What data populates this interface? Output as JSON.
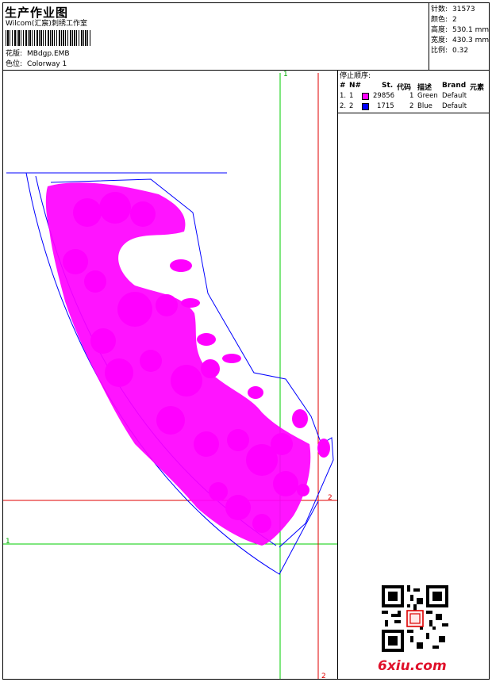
{
  "header": {
    "title": "生产作业图",
    "studio": "Wilcom(汇宸)刺绣工作室",
    "design_label": "花版:",
    "design_value": "MBdgp.EMB",
    "colorway_label": "色位:",
    "colorway_value": "Colorway 1"
  },
  "stats": [
    {
      "label": "针数:",
      "value": "31573"
    },
    {
      "label": "颜色:",
      "value": "2"
    },
    {
      "label": "高度:",
      "value": "530.1 mm"
    },
    {
      "label": "宽度:",
      "value": "430.3 mm"
    },
    {
      "label": "比例:",
      "value": "0.32"
    }
  ],
  "stop_sequence": {
    "title": "停止顺序:",
    "columns": [
      "#",
      "N#",
      "St.",
      "代码",
      "描述",
      "Brand",
      "元素"
    ],
    "rows": [
      {
        "index": "1.",
        "n": "1",
        "color": "#ff00ff",
        "stitches": "29856",
        "code": "1",
        "description": "Green",
        "brand": "Default"
      },
      {
        "index": "2.",
        "n": "2",
        "color": "#0000ff",
        "stitches": "1715",
        "code": "2",
        "description": "Blue",
        "brand": "Default"
      }
    ]
  },
  "guides": {
    "green_top_label": "1",
    "green_left_label": "1",
    "red_right_label": "2",
    "red_bottom_label": "2"
  },
  "colors": {
    "embroidery": "#ff00ff",
    "outline": "#0000ff",
    "guide_green": "#00cc00",
    "guide_red": "#e00000"
  },
  "watermark": {
    "site": "6xiu.com",
    "seal_icon": "seal-stamp"
  }
}
